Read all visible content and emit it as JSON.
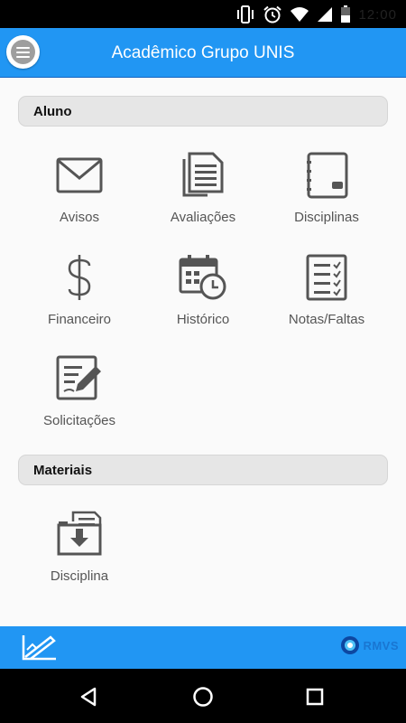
{
  "status_bar": {
    "clock": "12:00"
  },
  "app_bar": {
    "title": "Acadêmico Grupo UNIS"
  },
  "sections": {
    "aluno": {
      "title": "Aluno",
      "items": [
        {
          "label": "Avisos",
          "icon": "envelope-icon"
        },
        {
          "label": "Avaliações",
          "icon": "documents-icon"
        },
        {
          "label": "Disciplinas",
          "icon": "notebook-icon"
        },
        {
          "label": "Financeiro",
          "icon": "dollar-icon"
        },
        {
          "label": "Histórico",
          "icon": "calendar-clock-icon"
        },
        {
          "label": "Notas/Faltas",
          "icon": "checklist-icon"
        },
        {
          "label": "Solicitações",
          "icon": "edit-form-icon"
        }
      ]
    },
    "materiais": {
      "title": "Materiais",
      "items": [
        {
          "label": "Disciplina",
          "icon": "download-tray-icon"
        }
      ]
    }
  },
  "footer": {
    "brand": "RMVS"
  },
  "colors": {
    "primary": "#2196f3",
    "icon": "#555555",
    "section_bg": "#e6e6e6"
  }
}
